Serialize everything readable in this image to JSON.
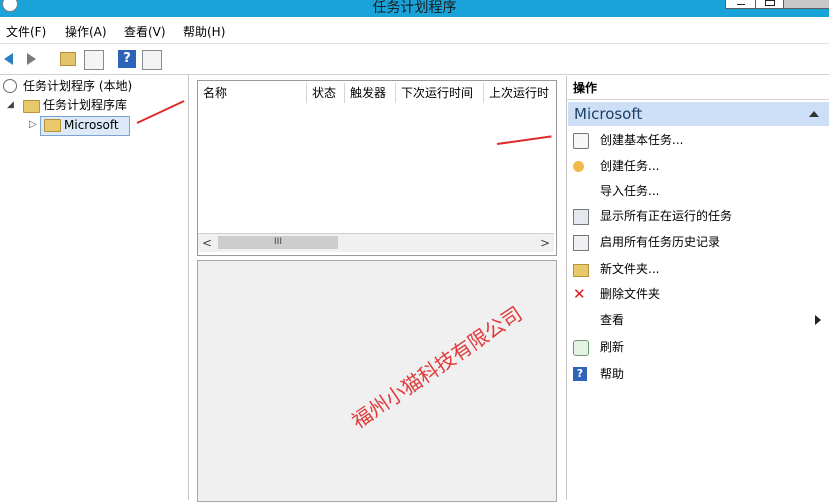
{
  "window": {
    "title": "任务计划程序"
  },
  "menu": {
    "file": "文件(F)",
    "action": "操作(A)",
    "view": "查看(V)",
    "help": "帮助(H)"
  },
  "tree": {
    "root": "任务计划程序 (本地)",
    "library": "任务计划程序库",
    "folder": "Microsoft"
  },
  "grid": {
    "columns": [
      "名称",
      "状态",
      "触发器",
      "下次运行时间",
      "上次运行时"
    ],
    "scroll_left": "<",
    "scroll_right": ">",
    "scroll_grip": "III"
  },
  "actions": {
    "header": "操作",
    "group": "Microsoft",
    "items": [
      {
        "label": "创建基本任务...",
        "icon": "create-basic-task-icon"
      },
      {
        "label": "创建任务...",
        "icon": "create-task-icon"
      },
      {
        "label": "导入任务...",
        "icon": ""
      },
      {
        "label": "显示所有正在运行的任务",
        "icon": "running-tasks-icon"
      },
      {
        "label": "启用所有任务历史记录",
        "icon": "task-history-icon"
      },
      {
        "label": "新文件夹...",
        "icon": "new-folder-icon"
      },
      {
        "label": "删除文件夹",
        "icon": "delete-icon"
      },
      {
        "label": "查看",
        "icon": ""
      },
      {
        "label": "刷新",
        "icon": "refresh-icon"
      },
      {
        "label": "帮助",
        "icon": "help-icon"
      }
    ]
  },
  "watermark": "福州小猫科技有限公司",
  "colors": {
    "titlebar": "#19a3d8",
    "selection": "#dbe9f8",
    "group_header": "#cddff6",
    "annotation": "#e02a2a"
  }
}
